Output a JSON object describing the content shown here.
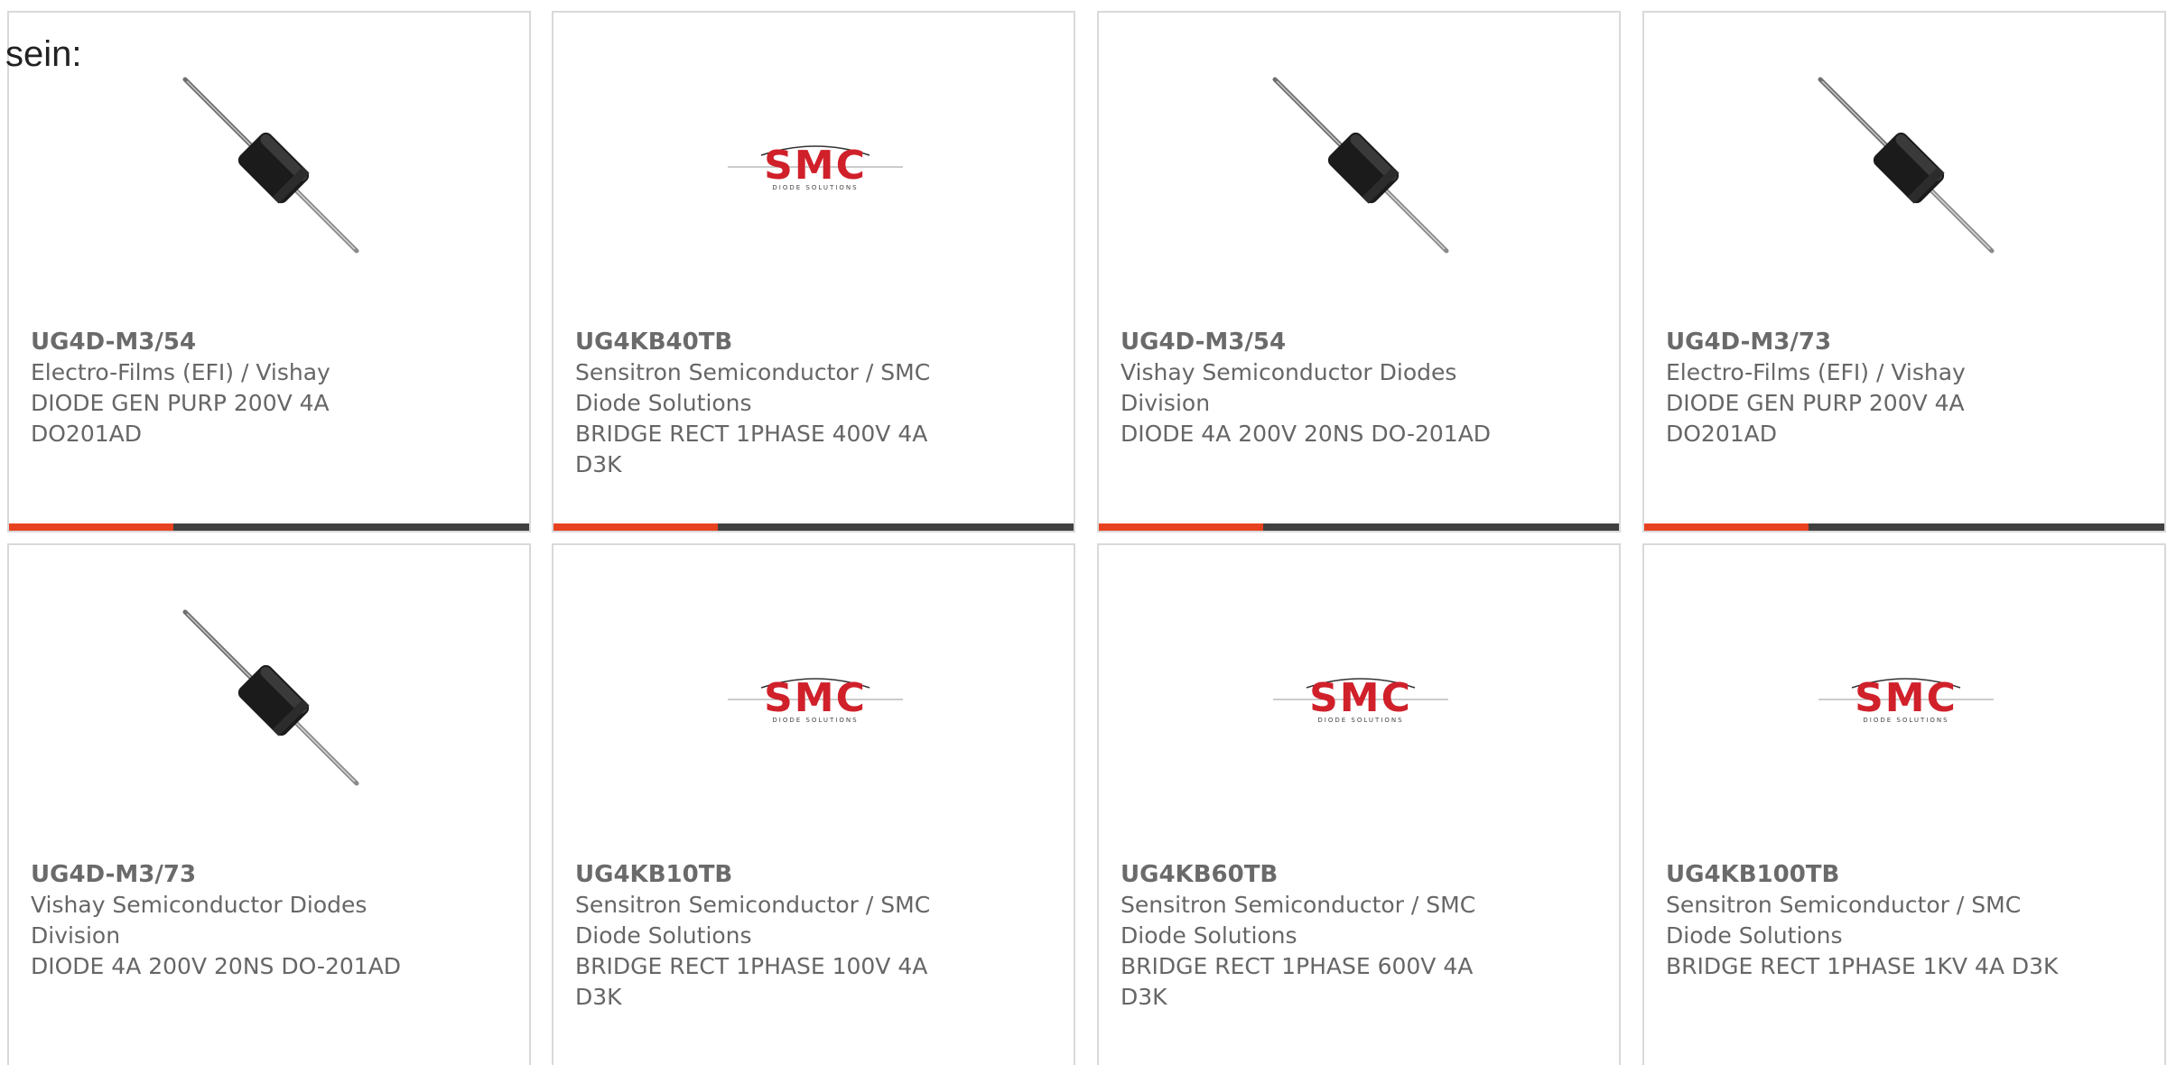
{
  "intro_text": "sein:",
  "colors": {
    "accent": "#e8411f",
    "bar_dark": "#404040",
    "smc_red": "#d0202a",
    "text": "#666666"
  },
  "products": [
    {
      "part": "UG4D-M3/54",
      "manufacturer": "Electro-Films (EFI) / Vishay",
      "description": "DIODE GEN PURP 200V 4A DO201AD",
      "image": "axial-diode"
    },
    {
      "part": "UG4KB40TB",
      "manufacturer": "Sensitron Semiconductor / SMC Diode Solutions",
      "description": "BRIDGE RECT 1PHASE 400V 4A D3K",
      "image": "smc-logo"
    },
    {
      "part": "UG4D-M3/54",
      "manufacturer": "Vishay Semiconductor Diodes Division",
      "description": "DIODE 4A 200V 20NS DO-201AD",
      "image": "axial-diode"
    },
    {
      "part": "UG4D-M3/73",
      "manufacturer": "Electro-Films (EFI) / Vishay",
      "description": "DIODE GEN PURP 200V 4A DO201AD",
      "image": "axial-diode"
    },
    {
      "part": "UG4D-M3/73",
      "manufacturer": "Vishay Semiconductor Diodes Division",
      "description": "DIODE 4A 200V 20NS DO-201AD",
      "image": "axial-diode"
    },
    {
      "part": "UG4KB10TB",
      "manufacturer": "Sensitron Semiconductor / SMC Diode Solutions",
      "description": "BRIDGE RECT 1PHASE 100V 4A D3K",
      "image": "smc-logo"
    },
    {
      "part": "UG4KB60TB",
      "manufacturer": "Sensitron Semiconductor / SMC Diode Solutions",
      "description": "BRIDGE RECT 1PHASE 600V 4A D3K",
      "image": "smc-logo"
    },
    {
      "part": "UG4KB100TB",
      "manufacturer": "Sensitron Semiconductor / SMC Diode Solutions",
      "description": "BRIDGE RECT 1PHASE 1KV 4A D3K",
      "image": "smc-logo"
    }
  ],
  "smc_logo": {
    "brand": "SMC",
    "tagline": "DIODE SOLUTIONS"
  }
}
